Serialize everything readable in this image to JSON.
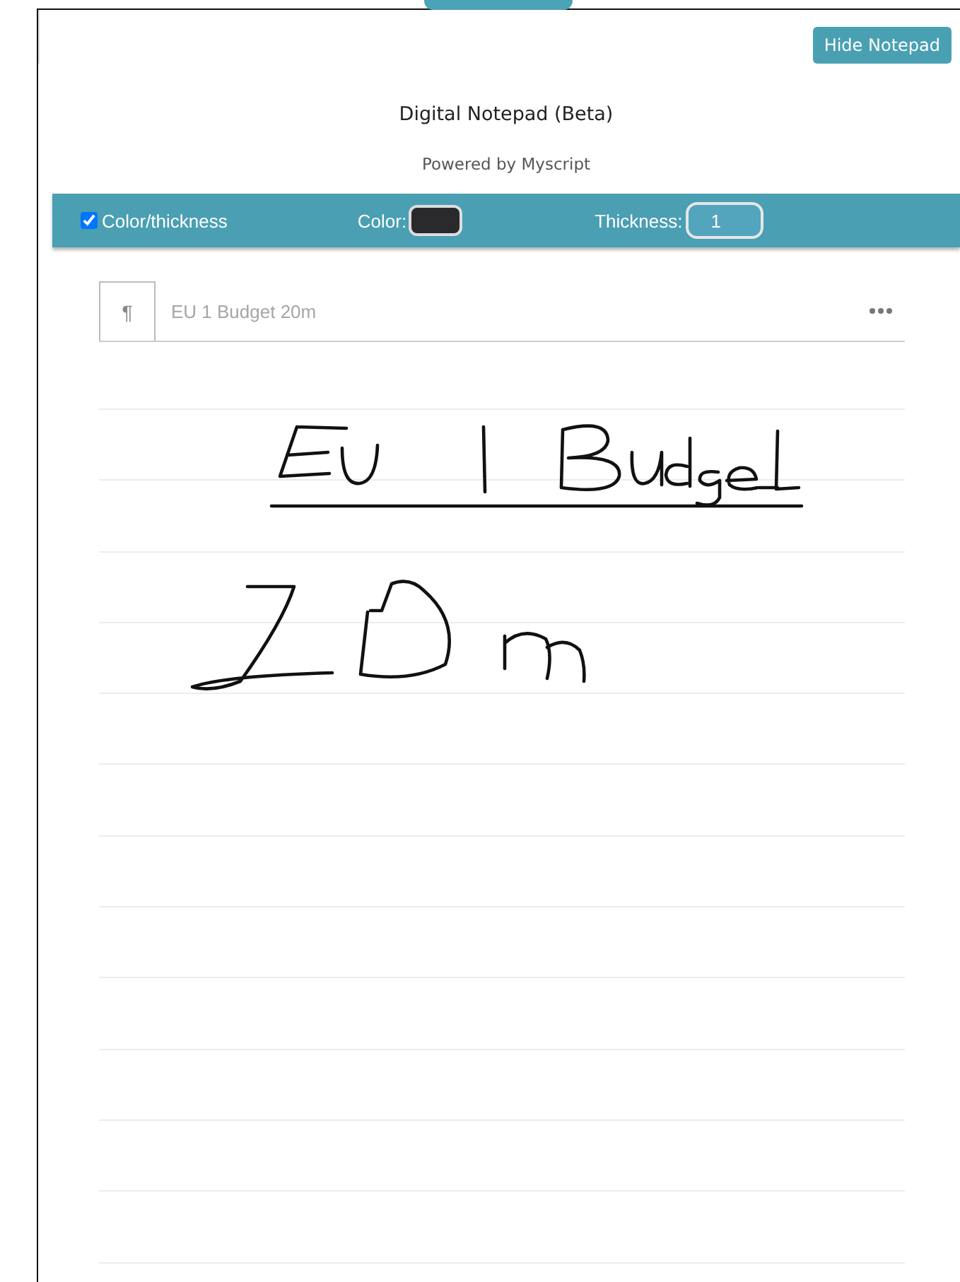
{
  "hide_button": "Hide Notepad",
  "title": "Digital Notepad (Beta)",
  "subtitle": "Powered by Myscript",
  "toolbar": {
    "toggle": {
      "label": "Color/thickness",
      "checked": true
    },
    "color": {
      "label": "Color:"
    },
    "thickness": {
      "label": "Thickness:",
      "value": "1"
    }
  },
  "result": {
    "symbol": "¶",
    "text": "EU 1 Budget 20m"
  }
}
